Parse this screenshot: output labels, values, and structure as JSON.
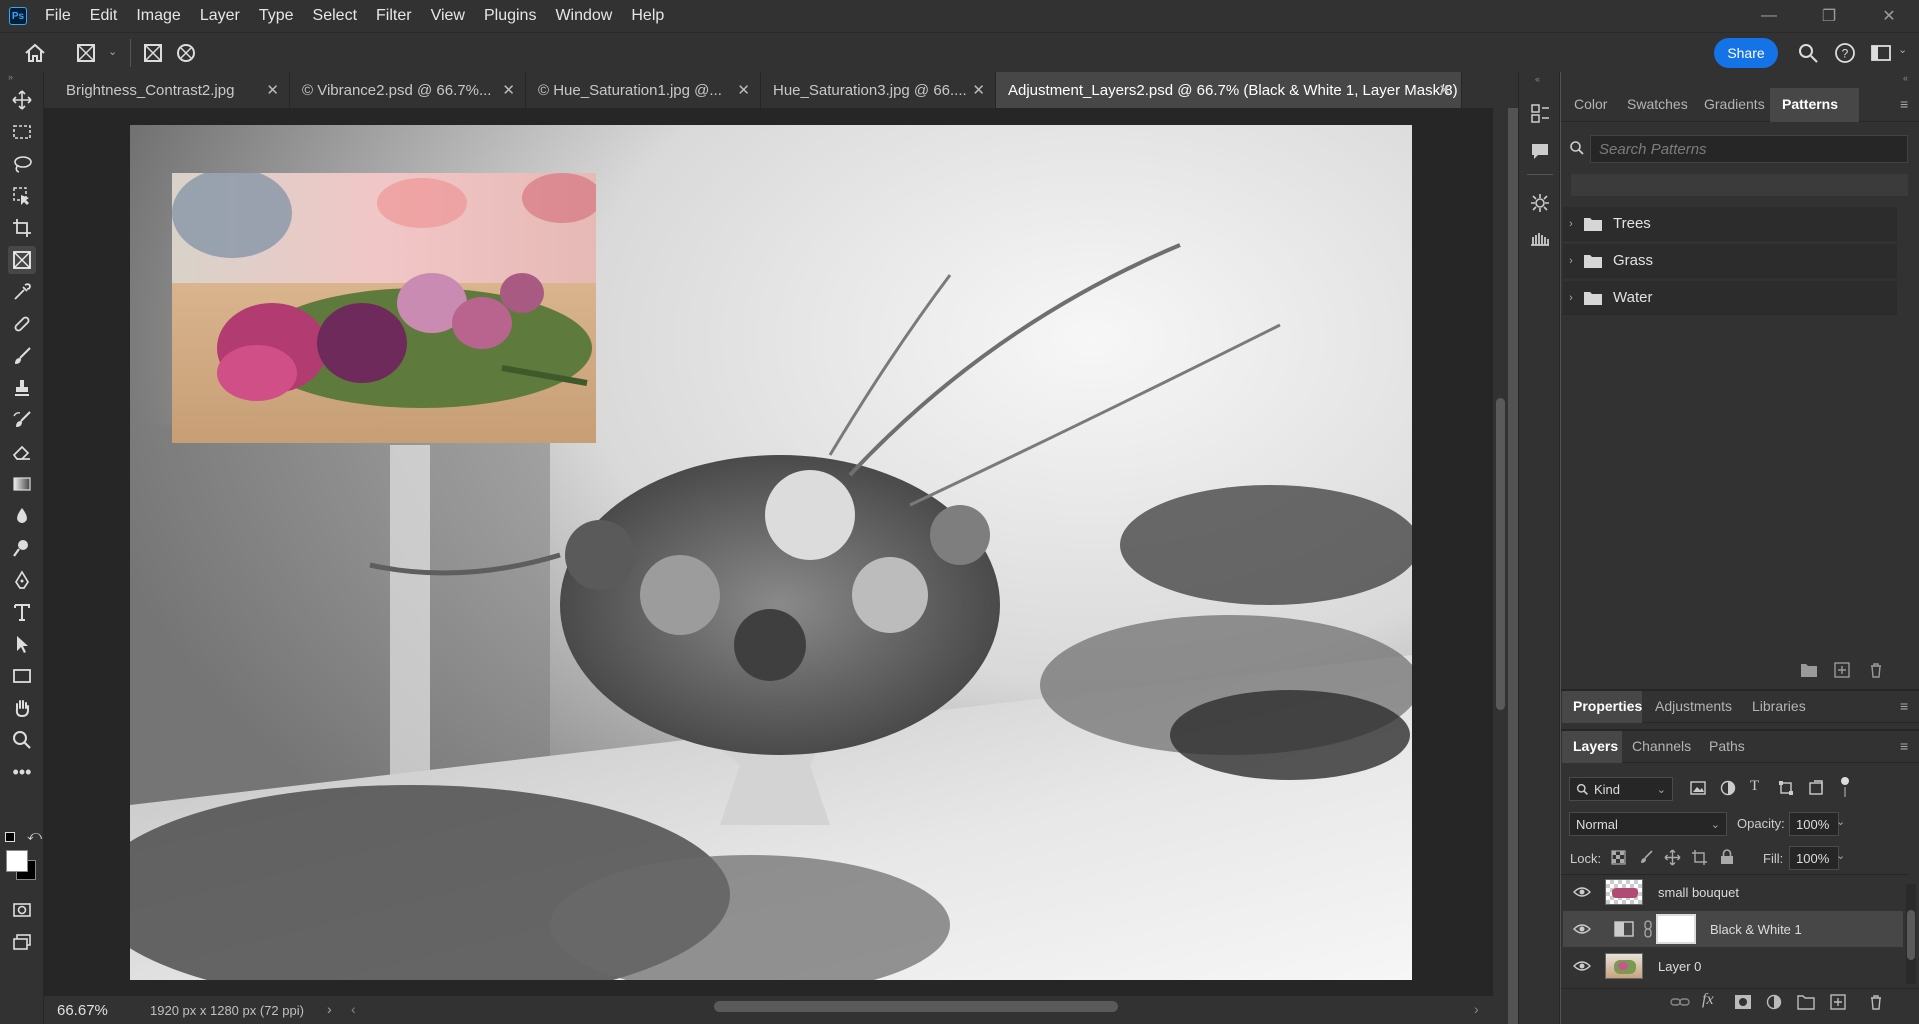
{
  "app": {
    "logo": "Ps"
  },
  "menu": [
    "File",
    "Edit",
    "Image",
    "Layer",
    "Type",
    "Select",
    "Filter",
    "View",
    "Plugins",
    "Window",
    "Help"
  ],
  "optionsbar": {
    "share_label": "Share"
  },
  "tabs": [
    {
      "label": "Brightness_Contrast2.jpg",
      "active": false
    },
    {
      "label": "© Vibrance2.psd @ 66.7%...",
      "active": false
    },
    {
      "label": "© Hue_Saturation1.jpg @...",
      "active": false
    },
    {
      "label": "Hue_Saturation3.jpg @ 66....",
      "active": false
    },
    {
      "label": "Adjustment_Layers2.psd @ 66.7% (Black & White 1, Layer Mask/8)",
      "active": true
    }
  ],
  "status": {
    "zoom": "66.67%",
    "doc_info": "1920 px x 1280 px (72 ppi)",
    "arrow": "›"
  },
  "patterns_panel": {
    "tabs": [
      "Color",
      "Swatches",
      "Gradients",
      "Patterns"
    ],
    "active_tab": "Patterns",
    "search_placeholder": "Search Patterns",
    "folders": [
      "Trees",
      "Grass",
      "Water"
    ]
  },
  "properties_panel": {
    "tabs": [
      "Properties",
      "Adjustments",
      "Libraries"
    ],
    "active_tab": "Properties"
  },
  "layers_panel": {
    "tabs": [
      "Layers",
      "Channels",
      "Paths"
    ],
    "active_tab": "Layers",
    "filter_kind": "Kind",
    "blend_mode": "Normal",
    "opacity_label": "Opacity:",
    "opacity_value": "100%",
    "lock_label": "Lock:",
    "fill_label": "Fill:",
    "fill_value": "100%",
    "layers": [
      {
        "name": "small bouquet",
        "selected": false
      },
      {
        "name": "Black & White 1",
        "selected": true
      },
      {
        "name": "Layer 0",
        "selected": false
      }
    ]
  }
}
